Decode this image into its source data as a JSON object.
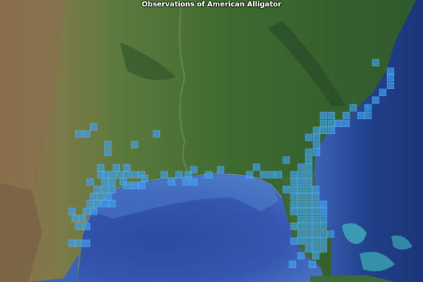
{
  "map": {
    "title": "Observations of American Alligator",
    "basemap": "satellite imagery",
    "colors": {
      "land_dark": "#2f5a2c",
      "land_mid": "#587a3e",
      "land_arid": "#9a7a55",
      "mountains": "#314d2a",
      "water_deep": "#23428c",
      "water_gulf": "#3a5bb0",
      "shallows": "#3a9fb0",
      "observation_cell": "#3aa0f0",
      "observation_cell_edge": "#8cc8ff"
    },
    "observations": {
      "species": "American Alligator",
      "cell_count": 149
    }
  }
}
